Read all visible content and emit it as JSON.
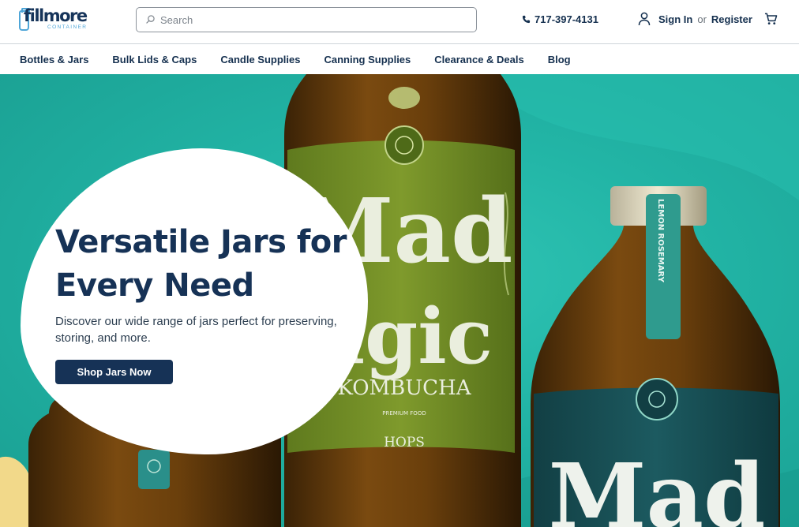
{
  "header": {
    "logo_text": "fillmore",
    "logo_subtext": "CONTAINER",
    "search": {
      "placeholder": "Search",
      "value": ""
    },
    "phone": "717-397-4131",
    "sign_in": "Sign In",
    "or_text": "or",
    "register": "Register"
  },
  "nav": {
    "items": [
      {
        "label": "Bottles & Jars"
      },
      {
        "label": "Bulk Lids & Caps"
      },
      {
        "label": "Candle Supplies"
      },
      {
        "label": "Canning Supplies"
      },
      {
        "label": "Clearance & Deals"
      },
      {
        "label": "Blog"
      }
    ]
  },
  "hero": {
    "title": "Versatile Jars for Every Need",
    "subtitle": "Discover our wide range of jars perfect for preserving, storing, and more.",
    "cta": "Shop Jars Now",
    "image_text": {
      "brand_main": "Mad",
      "brand_second": "agic",
      "product": "KOMBUCHA",
      "fine_print": "PREMIUM FOOD",
      "flavor": "HOPS",
      "brand_right": "Mad",
      "tag_text": "LEMON ROSEMARY"
    }
  },
  "colors": {
    "brand_navy": "#163256",
    "accent_blue": "#4fa6d8",
    "hero_teal": "#22b5a6"
  },
  "icons": [
    "search-icon",
    "phone-icon",
    "user-icon",
    "cart-icon"
  ]
}
